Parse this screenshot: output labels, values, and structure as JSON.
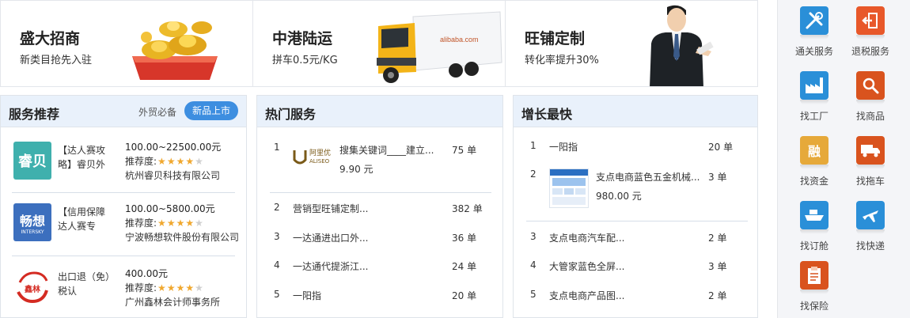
{
  "banners": [
    {
      "title": "盛大招商",
      "subtitle": "新类目抢先入驻",
      "image_icon": "gold-ingot-icon"
    },
    {
      "title": "中港陆运",
      "subtitle": "拼车0.5元/KG",
      "image_icon": "truck-icon"
    },
    {
      "title": "旺铺定制",
      "subtitle": "转化率提升30%",
      "image_icon": "businessman-icon"
    }
  ],
  "side_services": [
    {
      "label": "通关服务",
      "icon": "wrench-tools-icon",
      "color": "#2a8fd8"
    },
    {
      "label": "退税服务",
      "icon": "exit-arrow-icon",
      "color": "#e8582a"
    },
    {
      "label": "找工厂",
      "icon": "factory-icon",
      "color": "#2a8fd8"
    },
    {
      "label": "找商品",
      "icon": "magnifier-icon",
      "color": "#d9531e"
    },
    {
      "label": "找资金",
      "icon": "finance-icon",
      "color": "#e6a93a",
      "glyph": "融"
    },
    {
      "label": "找拖车",
      "icon": "trailer-truck-icon",
      "color": "#d9531e"
    },
    {
      "label": "找订舱",
      "icon": "ship-icon",
      "color": "#2a8fd8"
    },
    {
      "label": "找快递",
      "icon": "airplane-icon",
      "color": "#2a8fd8"
    },
    {
      "label": "找保险",
      "icon": "clipboard-icon",
      "color": "#d9531e"
    }
  ],
  "recommend": {
    "title": "服务推荐",
    "extra": "外贸必备",
    "new_label": "新品上市",
    "rating_label": "推荐度:",
    "items": [
      {
        "logo_text": "睿贝",
        "logo_color": "#3fb0ad",
        "name": "【达人赛攻略】睿贝外",
        "price": "100.00~22500.00元",
        "stars": 4,
        "company": "杭州睿贝科技有限公司"
      },
      {
        "logo_text": "畅想",
        "logo_sub": "INTERSKY",
        "logo_color": "#3c6fbe",
        "name": "【信用保障达人赛专",
        "price": "100.00~5800.00元",
        "stars": 4,
        "company": "宁波畅想软件股份有限公司"
      },
      {
        "logo_text": "鑫林",
        "logo_color": "#ffffff",
        "name": "出口退（免）税认",
        "price": "400.00元",
        "stars": 4,
        "company": "广州鑫林会计师事务所"
      }
    ]
  },
  "hot": {
    "title": "热门服务",
    "unit": "单",
    "featured": {
      "rank": "1",
      "logo_text": "阿里优",
      "logo_sub": "ALISEO",
      "name": "搜集关键词____建立...",
      "price": "9.90 元",
      "count": "75"
    },
    "items": [
      {
        "rank": "2",
        "name": "营销型旺铺定制...",
        "count": "382"
      },
      {
        "rank": "3",
        "name": "一达通进出口外...",
        "count": "36"
      },
      {
        "rank": "4",
        "name": "一达通代提浙江...",
        "count": "24"
      },
      {
        "rank": "5",
        "name": "一阳指",
        "count": "20"
      }
    ]
  },
  "growth": {
    "title": "增长最快",
    "unit": "单",
    "items_top": [
      {
        "rank": "1",
        "name": "一阳指",
        "count": "20"
      }
    ],
    "featured": {
      "rank": "2",
      "name": "支点电商蓝色五金机械...",
      "price": "980.00 元",
      "count": "3"
    },
    "items": [
      {
        "rank": "3",
        "name": "支点电商汽车配...",
        "count": "2"
      },
      {
        "rank": "4",
        "name": "大管家蓝色全屏...",
        "count": "3"
      },
      {
        "rank": "5",
        "name": "支点电商产品图...",
        "count": "2"
      }
    ]
  }
}
